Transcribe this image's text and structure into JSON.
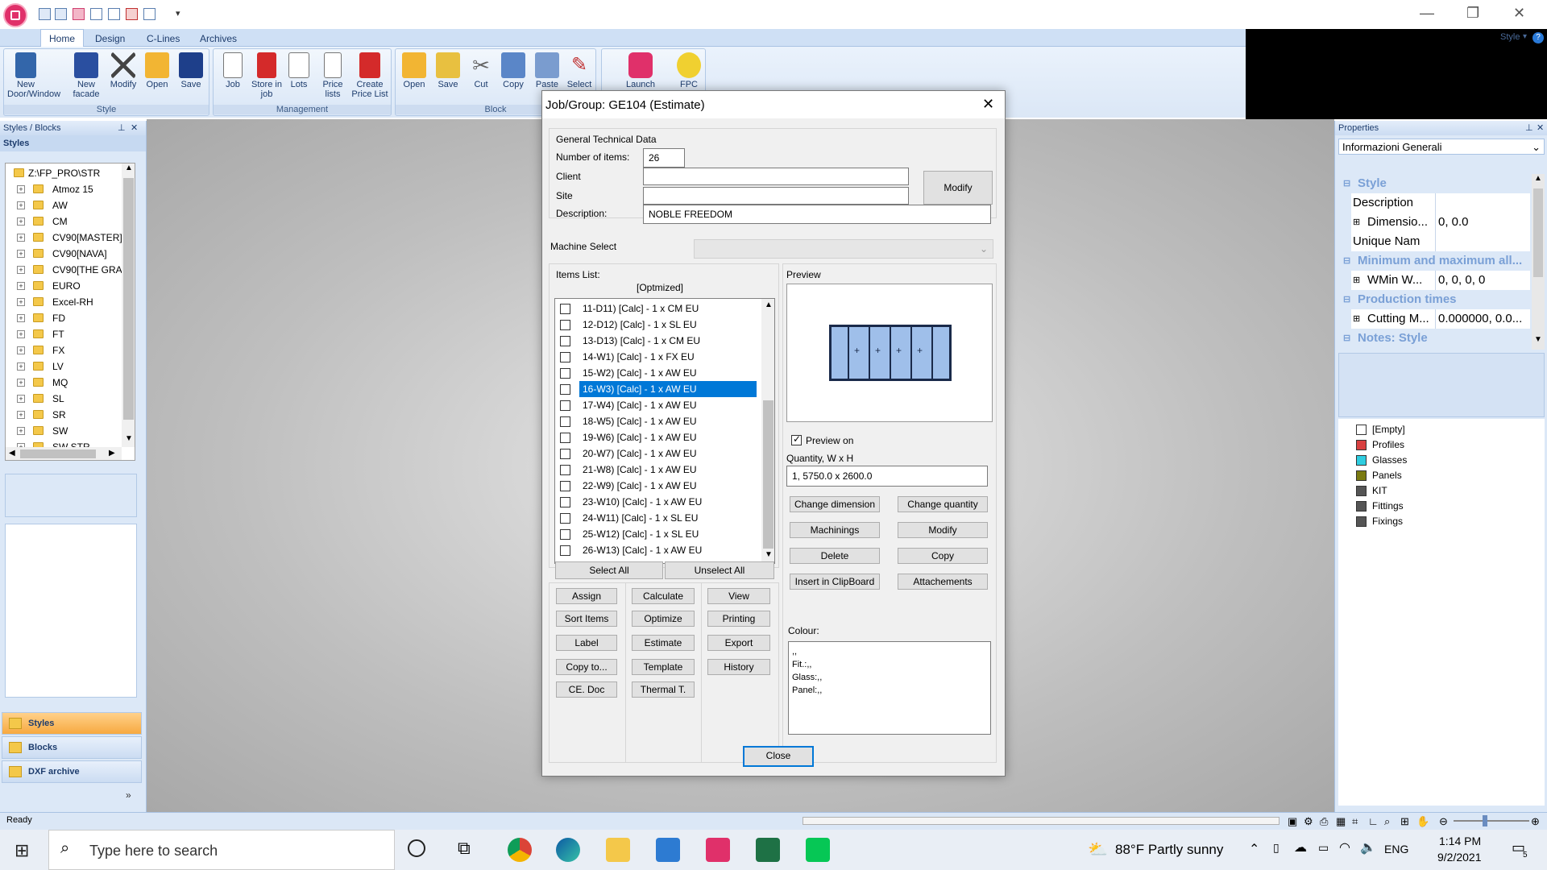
{
  "app": {
    "quick_access_icons": [
      "new-icon",
      "open-icon",
      "window-icon",
      "app-icon",
      "import-icon",
      "export-icon",
      "pdf-icon",
      "tool-icon"
    ],
    "dropdown_glyph": "▾"
  },
  "ribbon": {
    "tabs": [
      "Home",
      "Design",
      "C-Lines",
      "Archives"
    ],
    "style_label": "Style",
    "groups": {
      "style": {
        "name": "Style",
        "buttons": [
          "New Door/Window",
          "New facade",
          "Modify",
          "Open",
          "Save"
        ]
      },
      "management": {
        "name": "Management",
        "buttons": [
          "Job",
          "Store in job",
          "Lots",
          "Price lists",
          "Create Price List"
        ]
      },
      "block": {
        "name": "Block",
        "buttons": [
          "Open",
          "Save",
          "Cut",
          "Copy",
          "Paste",
          "Select"
        ]
      },
      "launch": {
        "buttons": [
          "Launch FP_PRO",
          "FPC"
        ]
      }
    }
  },
  "left_pane": {
    "title": "Styles / Blocks",
    "subtitle": "Styles",
    "root": "Z:\\FP_PRO\\STR",
    "items": [
      "Atmoz 15",
      "AW",
      "CM",
      "CV90[MASTER]",
      "CV90[NAVA]",
      "CV90[THE GRA",
      "EURO",
      "Excel-RH",
      "FD",
      "FT",
      "FX",
      "LV",
      "MQ",
      "SL",
      "SR",
      "SW",
      "SW STR"
    ],
    "nav": [
      "Styles",
      "Blocks",
      "DXF archive"
    ]
  },
  "right_pane": {
    "title": "Properties",
    "dropdown": "Informazioni Generali",
    "rows": [
      {
        "type": "cat",
        "label": "Style"
      },
      {
        "type": "row",
        "label": "Description",
        "value": ""
      },
      {
        "type": "row",
        "label": "Dimensio...",
        "value": "0, 0.0",
        "expand": true
      },
      {
        "type": "row",
        "label": "Unique Name",
        "value": ""
      },
      {
        "type": "cat",
        "label": "Minimum and maximum all..."
      },
      {
        "type": "row",
        "label": "WMin W...",
        "value": "0, 0, 0, 0",
        "expand": true
      },
      {
        "type": "cat",
        "label": "Production times"
      },
      {
        "type": "row",
        "label": "Cutting M...",
        "value": "0.000000, 0.0...",
        "expand": true
      },
      {
        "type": "cat",
        "label": "Notes: Style"
      }
    ],
    "legend": [
      {
        "label": "[Empty]",
        "color": "#ffffff"
      },
      {
        "label": "Profiles",
        "color": "#d84040"
      },
      {
        "label": "Glasses",
        "color": "#2ecde0"
      },
      {
        "label": "Panels",
        "color": "#7a7a10"
      },
      {
        "label": "KIT",
        "color": "#555555"
      },
      {
        "label": "Fittings",
        "color": "#555555"
      },
      {
        "label": "Fixings",
        "color": "#555555"
      }
    ]
  },
  "status": {
    "text": "Ready"
  },
  "dialog": {
    "title": "Job/Group: GE104 (Estimate)",
    "general_label": "General Technical Data",
    "number_label": "Number of items:",
    "number_value": "26",
    "client_label": "Client",
    "client_value": "",
    "site_label": "Site",
    "site_value": "",
    "description_label": "Description:",
    "description_value": "NOBLE FREEDOM",
    "modify_label": "Modify",
    "machine_label": "Machine Select",
    "items_label": "Items List:",
    "optimized_label": "[Optmized]",
    "items": [
      "11-D11) [Calc] - 1 x CM EU",
      "12-D12) [Calc] - 1 x SL EU",
      "13-D13) [Calc] - 1 x CM EU",
      "14-W1) [Calc] - 1 x FX EU",
      "15-W2) [Calc] - 1 x AW EU",
      "16-W3) [Calc] - 1 x AW EU",
      "17-W4) [Calc] - 1 x AW EU",
      "18-W5) [Calc] - 1 x AW EU",
      "19-W6) [Calc] - 1 x AW EU",
      "20-W7) [Calc] - 1 x AW EU",
      "21-W8) [Calc] - 1 x AW EU",
      "22-W9) [Calc] - 1 x AW EU",
      "23-W10) [Calc] - 1 x AW EU",
      "24-W11) [Calc] - 1 x SL EU",
      "25-W12) [Calc] - 1 x SL EU",
      "26-W13) [Calc] - 1 x AW EU"
    ],
    "selected_index": 5,
    "select_all": "Select All",
    "unselect_all": "Unselect All",
    "actions_col1": [
      "Assign",
      "Sort Items",
      "Label",
      "Copy to...",
      "CE. Doc"
    ],
    "actions_col2": [
      "Calculate",
      "Optimize",
      "Estimate",
      "Template",
      "Thermal T."
    ],
    "actions_col3": [
      "View",
      "Printing",
      "Export",
      "History"
    ],
    "preview_label": "Preview",
    "preview_on_label": "Preview on",
    "preview_on": true,
    "qty_label": "Quantity, W x H",
    "qty_value": "1, 5750.0 x 2600.0",
    "right_buttons": [
      "Change dimension",
      "Change quantity",
      "Machinings",
      "Modify",
      "Delete",
      "Copy",
      "Insert in ClipBoard",
      "Attachements"
    ],
    "colour_label": "Colour:",
    "colour_lines": [
      ",,",
      "Fit.:,,",
      "Glass:,,",
      "Panel:,,"
    ],
    "close_label": "Close"
  },
  "taskbar": {
    "search_placeholder": "Type here to search",
    "weather": "88°F  Partly sunny",
    "lang": "ENG",
    "time": "1:14 PM",
    "date": "9/2/2021",
    "notif_count": "5"
  }
}
